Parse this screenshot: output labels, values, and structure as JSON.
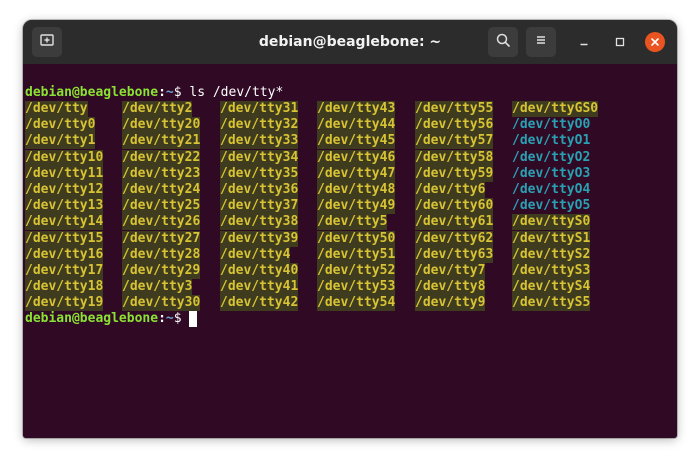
{
  "window": {
    "title": "debian@beaglebone: ~",
    "icons": {
      "new_tab": "new-tab-icon",
      "search": "search-icon",
      "menu": "hamburger-menu-icon",
      "minimize": "minimize-icon",
      "maximize": "maximize-icon",
      "close": "close-icon"
    },
    "colors": {
      "close_button": "#e95420",
      "terminal_background": "#300a24",
      "titlebar": "#2c2c2c"
    }
  },
  "terminal": {
    "prompt": {
      "user_host": "debian@beaglebone",
      "colon": ":",
      "path": "~",
      "symbol": "$ "
    },
    "command": "ls /dev/tty*",
    "colors": {
      "prompt_user": "#8ae234",
      "prompt_path": "#729fcf",
      "device_entry_text": "#d8c334",
      "device_entry_highlight": "#3e3b1e",
      "plain_entry_text": "#2aa1b3"
    },
    "columns": [
      {
        "entries": [
          {
            "name": "/dev/tty",
            "highlight": true
          },
          {
            "name": "/dev/tty0",
            "highlight": true
          },
          {
            "name": "/dev/tty1",
            "highlight": true
          },
          {
            "name": "/dev/tty10",
            "highlight": true
          },
          {
            "name": "/dev/tty11",
            "highlight": true
          },
          {
            "name": "/dev/tty12",
            "highlight": true
          },
          {
            "name": "/dev/tty13",
            "highlight": true
          },
          {
            "name": "/dev/tty14",
            "highlight": true
          },
          {
            "name": "/dev/tty15",
            "highlight": true
          },
          {
            "name": "/dev/tty16",
            "highlight": true
          },
          {
            "name": "/dev/tty17",
            "highlight": true
          },
          {
            "name": "/dev/tty18",
            "highlight": true
          },
          {
            "name": "/dev/tty19",
            "highlight": true
          }
        ]
      },
      {
        "entries": [
          {
            "name": "/dev/tty2",
            "highlight": true
          },
          {
            "name": "/dev/tty20",
            "highlight": true
          },
          {
            "name": "/dev/tty21",
            "highlight": true
          },
          {
            "name": "/dev/tty22",
            "highlight": true
          },
          {
            "name": "/dev/tty23",
            "highlight": true
          },
          {
            "name": "/dev/tty24",
            "highlight": true
          },
          {
            "name": "/dev/tty25",
            "highlight": true
          },
          {
            "name": "/dev/tty26",
            "highlight": true
          },
          {
            "name": "/dev/tty27",
            "highlight": true
          },
          {
            "name": "/dev/tty28",
            "highlight": true
          },
          {
            "name": "/dev/tty29",
            "highlight": true
          },
          {
            "name": "/dev/tty3",
            "highlight": true
          },
          {
            "name": "/dev/tty30",
            "highlight": true
          }
        ]
      },
      {
        "entries": [
          {
            "name": "/dev/tty31",
            "highlight": true
          },
          {
            "name": "/dev/tty32",
            "highlight": true
          },
          {
            "name": "/dev/tty33",
            "highlight": true
          },
          {
            "name": "/dev/tty34",
            "highlight": true
          },
          {
            "name": "/dev/tty35",
            "highlight": true
          },
          {
            "name": "/dev/tty36",
            "highlight": true
          },
          {
            "name": "/dev/tty37",
            "highlight": true
          },
          {
            "name": "/dev/tty38",
            "highlight": true
          },
          {
            "name": "/dev/tty39",
            "highlight": true
          },
          {
            "name": "/dev/tty4",
            "highlight": true
          },
          {
            "name": "/dev/tty40",
            "highlight": true
          },
          {
            "name": "/dev/tty41",
            "highlight": true
          },
          {
            "name": "/dev/tty42",
            "highlight": true
          }
        ]
      },
      {
        "entries": [
          {
            "name": "/dev/tty43",
            "highlight": true
          },
          {
            "name": "/dev/tty44",
            "highlight": true
          },
          {
            "name": "/dev/tty45",
            "highlight": true
          },
          {
            "name": "/dev/tty46",
            "highlight": true
          },
          {
            "name": "/dev/tty47",
            "highlight": true
          },
          {
            "name": "/dev/tty48",
            "highlight": true
          },
          {
            "name": "/dev/tty49",
            "highlight": true
          },
          {
            "name": "/dev/tty5",
            "highlight": true
          },
          {
            "name": "/dev/tty50",
            "highlight": true
          },
          {
            "name": "/dev/tty51",
            "highlight": true
          },
          {
            "name": "/dev/tty52",
            "highlight": true
          },
          {
            "name": "/dev/tty53",
            "highlight": true
          },
          {
            "name": "/dev/tty54",
            "highlight": true
          }
        ]
      },
      {
        "entries": [
          {
            "name": "/dev/tty55",
            "highlight": true
          },
          {
            "name": "/dev/tty56",
            "highlight": true
          },
          {
            "name": "/dev/tty57",
            "highlight": true
          },
          {
            "name": "/dev/tty58",
            "highlight": true
          },
          {
            "name": "/dev/tty59",
            "highlight": true
          },
          {
            "name": "/dev/tty6",
            "highlight": true
          },
          {
            "name": "/dev/tty60",
            "highlight": true
          },
          {
            "name": "/dev/tty61",
            "highlight": true
          },
          {
            "name": "/dev/tty62",
            "highlight": true
          },
          {
            "name": "/dev/tty63",
            "highlight": true
          },
          {
            "name": "/dev/tty7",
            "highlight": true
          },
          {
            "name": "/dev/tty8",
            "highlight": true
          },
          {
            "name": "/dev/tty9",
            "highlight": true
          }
        ]
      },
      {
        "entries": [
          {
            "name": "/dev/ttyGS0",
            "highlight": true
          },
          {
            "name": "/dev/ttyO0",
            "highlight": false
          },
          {
            "name": "/dev/ttyO1",
            "highlight": false
          },
          {
            "name": "/dev/ttyO2",
            "highlight": false
          },
          {
            "name": "/dev/ttyO3",
            "highlight": false
          },
          {
            "name": "/dev/ttyO4",
            "highlight": false
          },
          {
            "name": "/dev/ttyO5",
            "highlight": false
          },
          {
            "name": "/dev/ttyS0",
            "highlight": true
          },
          {
            "name": "/dev/ttyS1",
            "highlight": true
          },
          {
            "name": "/dev/ttyS2",
            "highlight": true
          },
          {
            "name": "/dev/ttyS3",
            "highlight": true
          },
          {
            "name": "/dev/ttyS4",
            "highlight": true
          },
          {
            "name": "/dev/ttyS5",
            "highlight": true
          }
        ]
      }
    ]
  }
}
